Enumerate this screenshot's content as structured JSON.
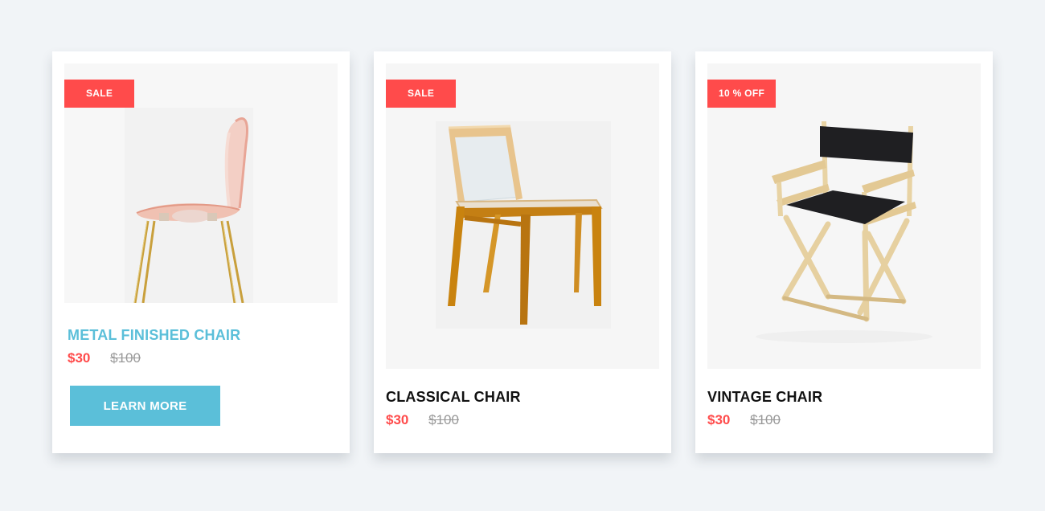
{
  "products": [
    {
      "badge": "SALE",
      "title": "METAL FINISHED CHAIR",
      "price_new": "$30",
      "price_old": "$100",
      "button_label": "LEARN MORE",
      "image": "pink-shell-chair-gold-legs-image"
    },
    {
      "badge": "SALE",
      "title": "CLASSICAL CHAIR",
      "price_new": "$30",
      "price_old": "$100",
      "image": "wooden-chair-acrylic-image"
    },
    {
      "badge": "10 % OFF",
      "title": "VINTAGE CHAIR",
      "price_new": "$30",
      "price_old": "$100",
      "image": "director-chair-image"
    }
  ],
  "colors": {
    "page_background": "#f1f4f7",
    "card_background": "#ffffff",
    "badge": "#ff4b4b",
    "accent": "#5bbfd9",
    "price_new": "#ff4b4b",
    "price_old": "#999999"
  }
}
